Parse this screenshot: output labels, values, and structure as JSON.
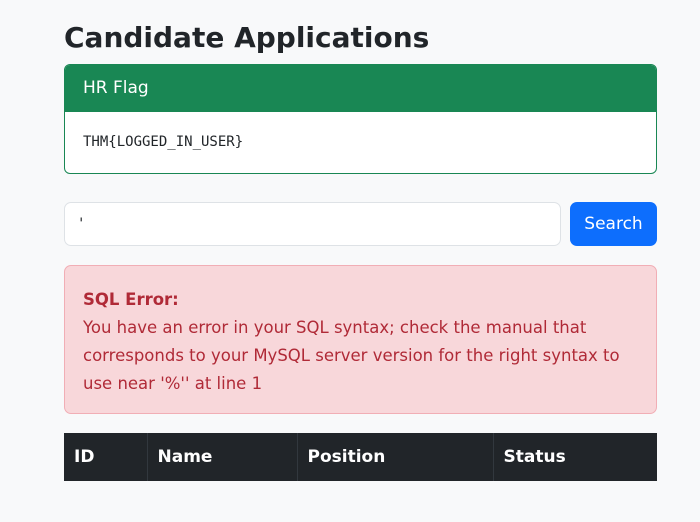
{
  "page": {
    "title": "Candidate Applications"
  },
  "hr_flag_card": {
    "header": "HR Flag",
    "flag_value": "THM{LOGGED_IN_USER}"
  },
  "search": {
    "value": "'",
    "button_label": "Search"
  },
  "error_alert": {
    "title": "SQL Error:",
    "message": "You have an error in your SQL syntax; check the manual that corresponds to your MySQL server version for the right syntax to use near '%'' at line 1"
  },
  "table": {
    "columns": [
      "ID",
      "Name",
      "Position",
      "Status"
    ]
  },
  "colors": {
    "success": "#198754",
    "primary": "#0d6efd",
    "danger_bg": "#f8d7da",
    "danger_text": "#b02a37",
    "table_dark": "#212529"
  }
}
